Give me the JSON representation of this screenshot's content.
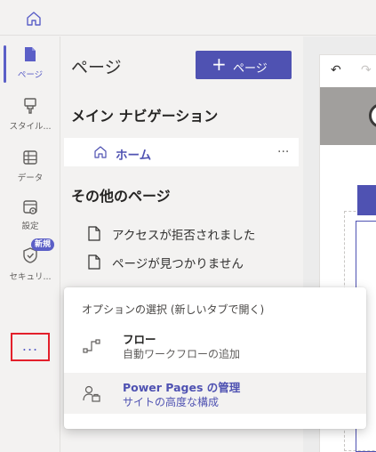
{
  "rail": {
    "items": [
      {
        "label": "ページ",
        "icon": "page-icon",
        "active": true
      },
      {
        "label": "スタイル...",
        "icon": "brush-icon"
      },
      {
        "label": "データ",
        "icon": "table-icon"
      },
      {
        "label": "設定",
        "icon": "settings-icon"
      },
      {
        "label": "セキュリ...",
        "icon": "shield-icon",
        "badge": "新規"
      }
    ],
    "more_label": "..."
  },
  "pages_panel": {
    "title": "ページ",
    "add_button": "ページ",
    "main_nav_title": "メイン ナビゲーション",
    "home_label": "ホーム",
    "home_more": "...",
    "other_pages_title": "その他のページ",
    "other_pages": [
      "アクセスが拒否されました",
      "ページが見つかりません"
    ]
  },
  "popover": {
    "header": "オプションの選択 (新しいタブで開く)",
    "items": [
      {
        "title": "フロー",
        "subtitle": "自動ワークフローの追加",
        "icon": "flow-icon"
      },
      {
        "title": "Power Pages の管理",
        "subtitle": "サイトの高度な構成",
        "icon": "admin-icon"
      }
    ]
  },
  "colors": {
    "accent": "#4f52b2",
    "highlight_border": "#e3202b",
    "background": "#f3f2f1"
  }
}
